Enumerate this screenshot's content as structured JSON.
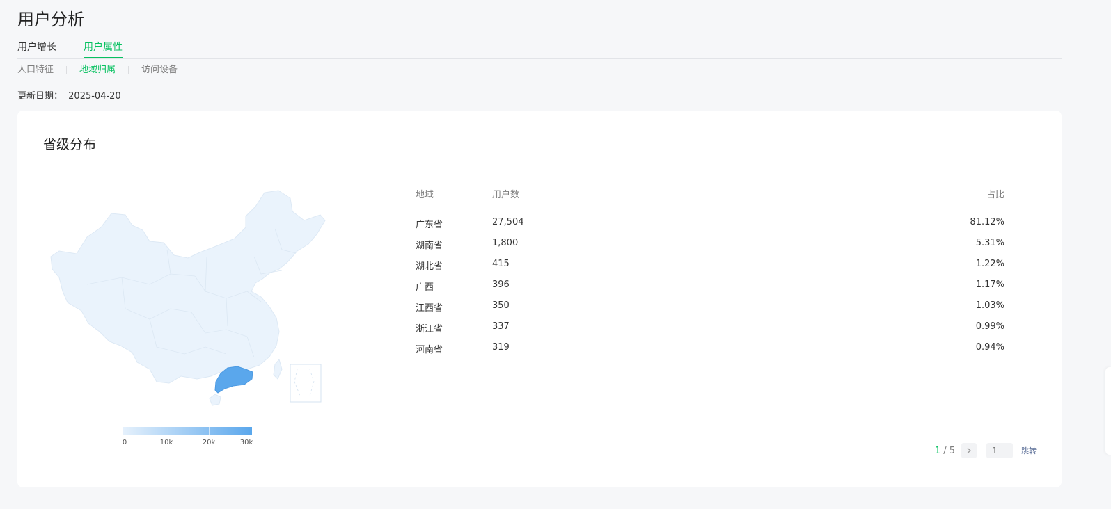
{
  "header": {
    "title": "用户分析"
  },
  "tabs": [
    {
      "label": "用户增长",
      "active": false
    },
    {
      "label": "用户属性",
      "active": true
    }
  ],
  "subtabs": [
    {
      "label": "人口特征",
      "active": false
    },
    {
      "label": "地域归属",
      "active": true
    },
    {
      "label": "访问设备",
      "active": false
    }
  ],
  "update": {
    "label": "更新日期：",
    "date": "2025-04-20"
  },
  "card": {
    "title": "省级分布"
  },
  "legend": {
    "labels": [
      "0",
      "10k",
      "20k",
      "30k"
    ],
    "color_low": "#e6f1fc",
    "color_high": "#5aa7ec"
  },
  "table": {
    "headers": {
      "region": "地域",
      "users": "用户数",
      "ratio": "占比"
    },
    "rows": [
      {
        "region": "广东省",
        "users": "27,504",
        "ratio": "81.12%"
      },
      {
        "region": "湖南省",
        "users": "1,800",
        "ratio": "5.31%"
      },
      {
        "region": "湖北省",
        "users": "415",
        "ratio": "1.22%"
      },
      {
        "region": "广西",
        "users": "396",
        "ratio": "1.17%"
      },
      {
        "region": "江西省",
        "users": "350",
        "ratio": "1.03%"
      },
      {
        "region": "浙江省",
        "users": "337",
        "ratio": "0.99%"
      },
      {
        "region": "河南省",
        "users": "319",
        "ratio": "0.94%"
      }
    ]
  },
  "pager": {
    "current": "1",
    "separator": " / ",
    "total": "5",
    "input_placeholder": "1",
    "jump_label": "跳转"
  },
  "colors": {
    "accent": "#07c160",
    "map_base": "#eaf3fc",
    "map_highlight": "#5aa7ec"
  },
  "icons": {
    "next": "chevron-right-icon"
  }
}
